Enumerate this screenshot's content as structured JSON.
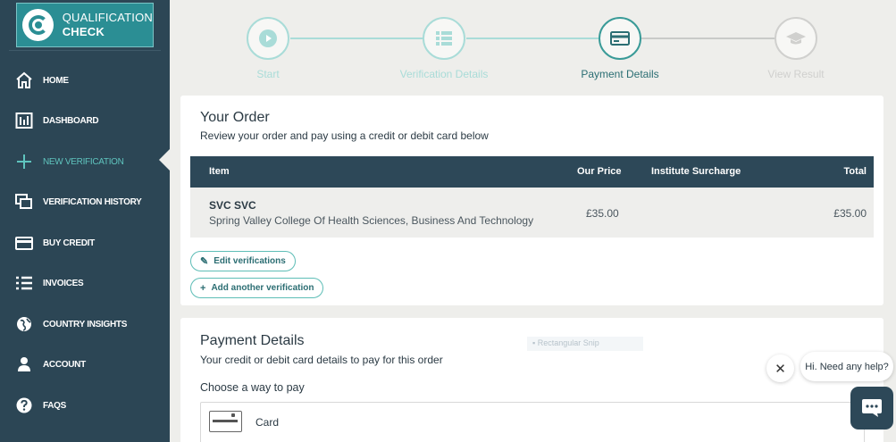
{
  "brand": {
    "line1": "QUALIFICATION",
    "line2": "CHECK"
  },
  "sidebar": {
    "items": [
      {
        "label": "HOME",
        "icon": "home-icon"
      },
      {
        "label": "DASHBOARD",
        "icon": "dashboard-icon"
      },
      {
        "label": "NEW VERIFICATION",
        "icon": "plus-icon",
        "active": true
      },
      {
        "label": "VERIFICATION HISTORY",
        "icon": "history-icon"
      },
      {
        "label": "BUY CREDIT",
        "icon": "credit-card-icon"
      },
      {
        "label": "INVOICES",
        "icon": "list-icon"
      },
      {
        "label": "COUNTRY INSIGHTS",
        "icon": "globe-icon"
      },
      {
        "label": "ACCOUNT",
        "icon": "user-icon"
      },
      {
        "label": "FAQS",
        "icon": "question-icon"
      }
    ]
  },
  "stepper": {
    "steps": [
      {
        "label": "Start",
        "state": "done",
        "icon": "play-icon"
      },
      {
        "label": "Verification Details",
        "state": "done",
        "icon": "list-icon"
      },
      {
        "label": "Payment Details",
        "state": "current",
        "icon": "credit-card-icon"
      },
      {
        "label": "View Result",
        "state": "pending",
        "icon": "graduation-cap-icon"
      }
    ]
  },
  "order": {
    "title": "Your Order",
    "subtitle": "Review your order and pay using a credit or debit card below",
    "columns": {
      "item": "Item",
      "price": "Our Price",
      "surcharge": "Institute Surcharge",
      "total": "Total"
    },
    "rows": [
      {
        "name": "SVC SVC",
        "institution": "Spring Valley College Of Health Sciences, Business And Technology",
        "price": "£35.00",
        "surcharge": "",
        "total": "£35.00"
      }
    ],
    "edit_label": "Edit verifications",
    "add_label": "Add another verification"
  },
  "payment": {
    "title": "Payment Details",
    "subtitle": "Your credit or debit card details to pay for this order",
    "overlay_text": "Rectangular Snip",
    "choose_label": "Choose a way to pay",
    "method_label": "Card"
  },
  "chat": {
    "prompt": "Hi. Need any help?"
  },
  "colors": {
    "sidebar": "#2c4655",
    "teal": "#5fc4be",
    "table_header": "#2d4858",
    "background": "#eeeeeb"
  }
}
